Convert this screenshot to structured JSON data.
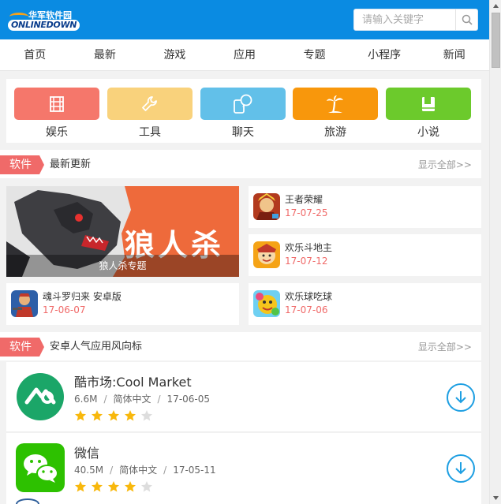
{
  "header": {
    "logo_cn": "华军软件园",
    "logo_en": "ONLINEDOWN",
    "search_placeholder": "请输入关键字"
  },
  "nav": [
    "首页",
    "最新",
    "游戏",
    "应用",
    "专题",
    "小程序",
    "新闻"
  ],
  "categories": [
    {
      "label": "娱乐",
      "color": "#f5776b",
      "icon": "film-icon"
    },
    {
      "label": "工具",
      "color": "#f9d27c",
      "icon": "wrench-icon"
    },
    {
      "label": "聊天",
      "color": "#62c0e9",
      "icon": "chat-icon"
    },
    {
      "label": "旅游",
      "color": "#f8970c",
      "icon": "palm-tree-icon"
    },
    {
      "label": "小说",
      "color": "#6cca2c",
      "icon": "book-icon"
    }
  ],
  "section1": {
    "tag": "软件",
    "title": "最新更新",
    "more": "显示全部>>",
    "banner": {
      "text": "狼人杀",
      "caption": "狼人杀专题"
    },
    "items": [
      {
        "name": "王者荣耀",
        "date": "17-07-25"
      },
      {
        "name": "欢乐斗地主",
        "date": "17-07-12"
      },
      {
        "name": "魂斗罗归来 安卓版",
        "date": "17-06-07"
      },
      {
        "name": "欢乐球吃球",
        "date": "17-07-06"
      }
    ]
  },
  "section2": {
    "tag": "软件",
    "title": "安卓人气应用风向标",
    "more": "显示全部>>",
    "apps": [
      {
        "name": "酷市场:Cool Market",
        "size": "6.6M",
        "lang": "简体中文",
        "date": "17-06-05",
        "rating": 4,
        "max_rating": 5
      },
      {
        "name": "微信",
        "size": "40.5M",
        "lang": "简体中文",
        "date": "17-05-11",
        "rating": 4,
        "max_rating": 5
      }
    ]
  },
  "colors": {
    "header_bg": "#0a8be2",
    "tag_red": "#f06a69",
    "star": "#f8b80c",
    "download": "#1e9fe2"
  }
}
